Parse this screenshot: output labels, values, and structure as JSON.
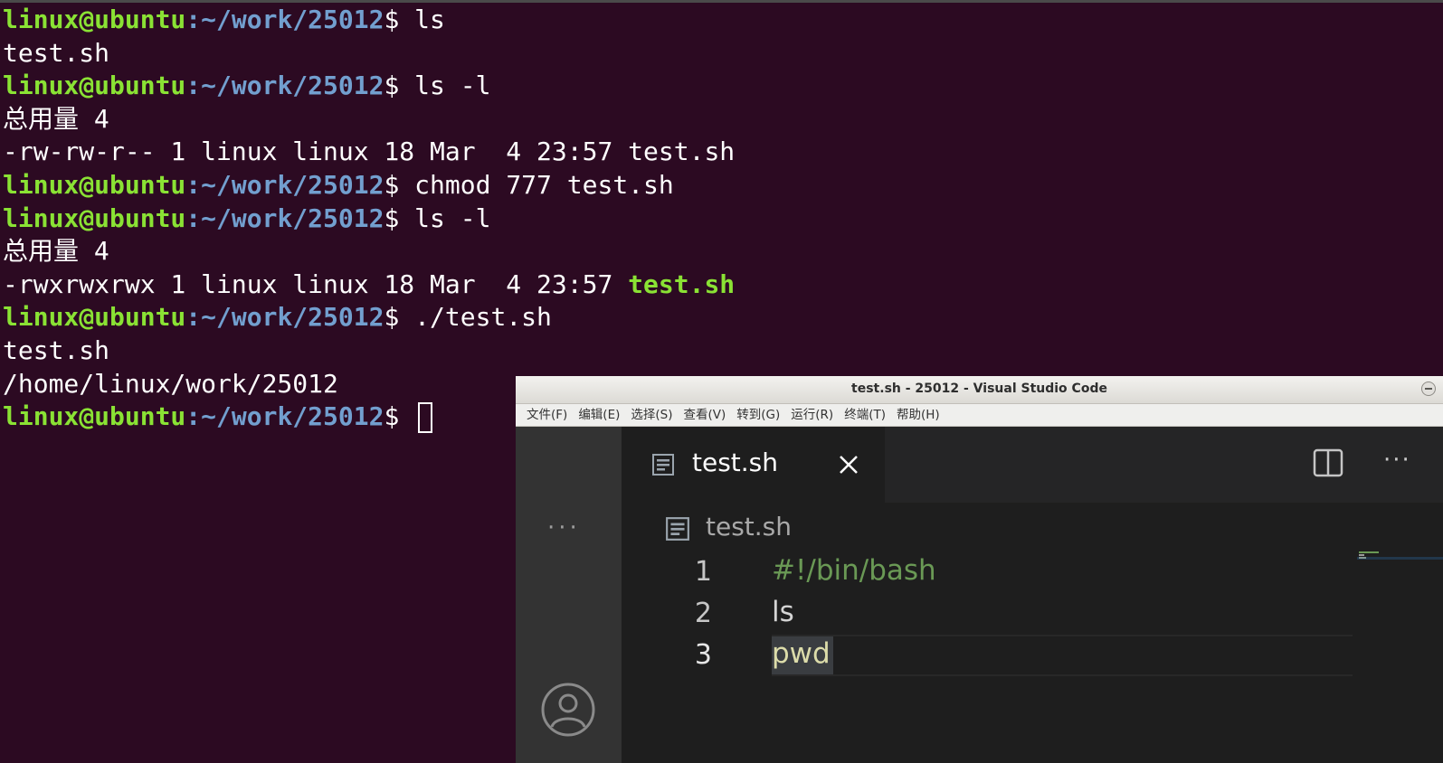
{
  "terminal": {
    "prompt_user": "linux@ubuntu",
    "prompt_path": ":~/work/25012",
    "prompt_symbol": "$ ",
    "lines": [
      {
        "type": "prompt",
        "cmd": "ls"
      },
      {
        "type": "out",
        "text": "test.sh"
      },
      {
        "type": "prompt",
        "cmd": "ls -l"
      },
      {
        "type": "out",
        "text": "总用量 4"
      },
      {
        "type": "out",
        "text": "-rw-rw-r-- 1 linux linux 18 Mar  4 23:57 test.sh"
      },
      {
        "type": "prompt",
        "cmd": "chmod 777 test.sh"
      },
      {
        "type": "prompt",
        "cmd": "ls -l"
      },
      {
        "type": "out",
        "text": "总用量 4"
      },
      {
        "type": "exe",
        "text": "-rwxrwxrwx 1 linux linux 18 Mar  4 23:57 ",
        "file": "test.sh"
      },
      {
        "type": "prompt",
        "cmd": "./test.sh"
      },
      {
        "type": "out",
        "text": "test.sh"
      },
      {
        "type": "out",
        "text": "/home/linux/work/25012"
      },
      {
        "type": "prompt",
        "cmd": "",
        "cursor": true
      }
    ],
    "colors": {
      "background": "#2c0a22",
      "user": "#8ae234",
      "path": "#729fcf",
      "text": "#ffffff"
    }
  },
  "vscode": {
    "window_title": "test.sh - 25012 - Visual Studio Code",
    "menu": [
      "文件(F)",
      "编辑(E)",
      "选择(S)",
      "查看(V)",
      "转到(G)",
      "运行(R)",
      "终端(T)",
      "帮助(H)"
    ],
    "tab": {
      "label": "test.sh",
      "icon": "file-lines-icon",
      "close_icon": "close-icon"
    },
    "editor_actions": {
      "split": "split-editor-icon",
      "more": "···"
    },
    "activity_bar": {
      "dots": "···",
      "account_icon": "account-icon"
    },
    "breadcrumb": {
      "label": "test.sh",
      "icon": "file-lines-icon"
    },
    "code": {
      "lines": [
        {
          "num": "1",
          "text": "#!/bin/bash",
          "kind": "comment"
        },
        {
          "num": "2",
          "text": "ls",
          "kind": "plain"
        },
        {
          "num": "3",
          "text": "pwd",
          "kind": "cmd"
        }
      ],
      "current_line": 3
    },
    "colors": {
      "editor_bg": "#1e1e1e",
      "comment": "#6a9955",
      "text": "#d4d4d4",
      "function": "#dcdcaa"
    }
  }
}
